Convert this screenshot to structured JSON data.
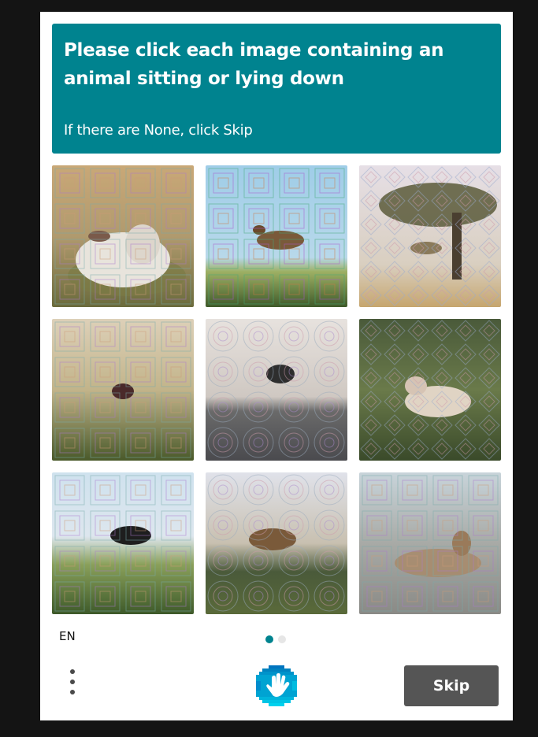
{
  "prompt": {
    "title": "Please click each image containing an animal sitting or lying down",
    "subtitle": "If there are None, click Skip",
    "bg_color": "#00838f"
  },
  "tiles": [
    {
      "name": "sheep-lying-grass"
    },
    {
      "name": "goat-jumping-sky"
    },
    {
      "name": "animal-jumping-tree"
    },
    {
      "name": "animal-jumping-field"
    },
    {
      "name": "animal-jumping-rocks"
    },
    {
      "name": "sheep-lying-grass-green"
    },
    {
      "name": "dog-running-field"
    },
    {
      "name": "goat-jumping-forest"
    },
    {
      "name": "deer-lying-snow"
    }
  ],
  "footer": {
    "language": "EN",
    "page_dots": [
      {
        "active": true
      },
      {
        "active": false
      }
    ],
    "menu_icon": "kebab-menu-icon",
    "logo_icon": "hcaptcha-hand-logo",
    "skip_label": "Skip"
  },
  "colors": {
    "accent": "#00838f",
    "skip_button": "#555555",
    "background": "#141414"
  }
}
